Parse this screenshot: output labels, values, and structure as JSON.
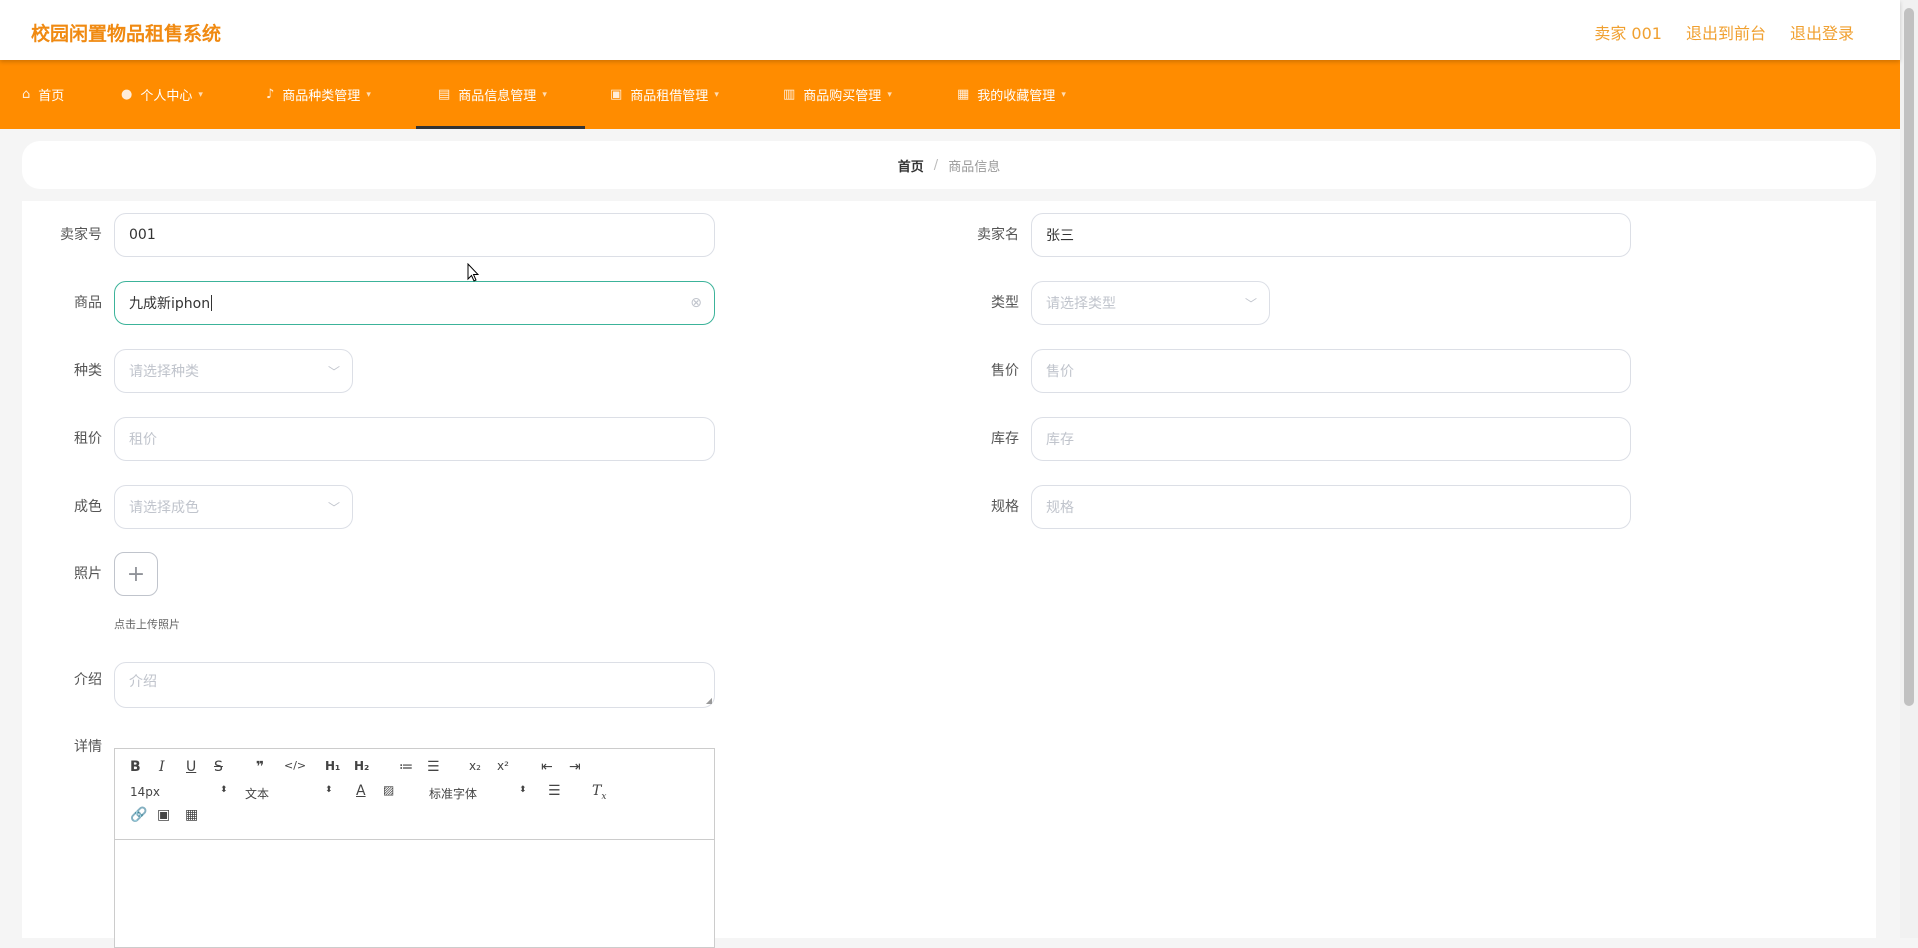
{
  "header": {
    "title": "校园闲置物品租售系统",
    "user_label": "卖家 001",
    "exit_front_label": "退出到前台",
    "logout_label": "退出登录",
    "accent_color": "#f08a12"
  },
  "nav": {
    "bg_color": "#ff8c00",
    "items": [
      {
        "label": "首页",
        "icon": "home-icon"
      },
      {
        "label": "个人中心",
        "icon": "user-icon"
      },
      {
        "label": "商品种类管理",
        "icon": "mic-icon"
      },
      {
        "label": "商品信息管理",
        "icon": "doc-icon",
        "active": true
      },
      {
        "label": "商品租借管理",
        "icon": "box-icon"
      },
      {
        "label": "商品购买管理",
        "icon": "grid-icon"
      },
      {
        "label": "我的收藏管理",
        "icon": "book-icon"
      }
    ]
  },
  "breadcrumb": {
    "home": "首页",
    "separator": "/",
    "current": "商品信息"
  },
  "form": {
    "seller_id": {
      "label": "卖家号",
      "value": "001"
    },
    "seller_name": {
      "label": "卖家名",
      "value": "张三"
    },
    "product": {
      "label": "商品",
      "value": "九成新iphon"
    },
    "type": {
      "label": "类型",
      "placeholder": "请选择类型"
    },
    "category": {
      "label": "种类",
      "placeholder": "请选择种类"
    },
    "sale_price": {
      "label": "售价",
      "placeholder": "售价"
    },
    "rent_price": {
      "label": "租价",
      "placeholder": "租价"
    },
    "stock": {
      "label": "库存",
      "placeholder": "库存"
    },
    "condition": {
      "label": "成色",
      "placeholder": "请选择成色"
    },
    "spec": {
      "label": "规格",
      "placeholder": "规格"
    },
    "photo": {
      "label": "照片",
      "hint": "点击上传照片"
    },
    "intro": {
      "label": "介绍",
      "placeholder": "介绍"
    },
    "details": {
      "label": "详情"
    }
  },
  "editor": {
    "font_size": "14px",
    "block_type": "文本",
    "font_family": "标准字体"
  }
}
